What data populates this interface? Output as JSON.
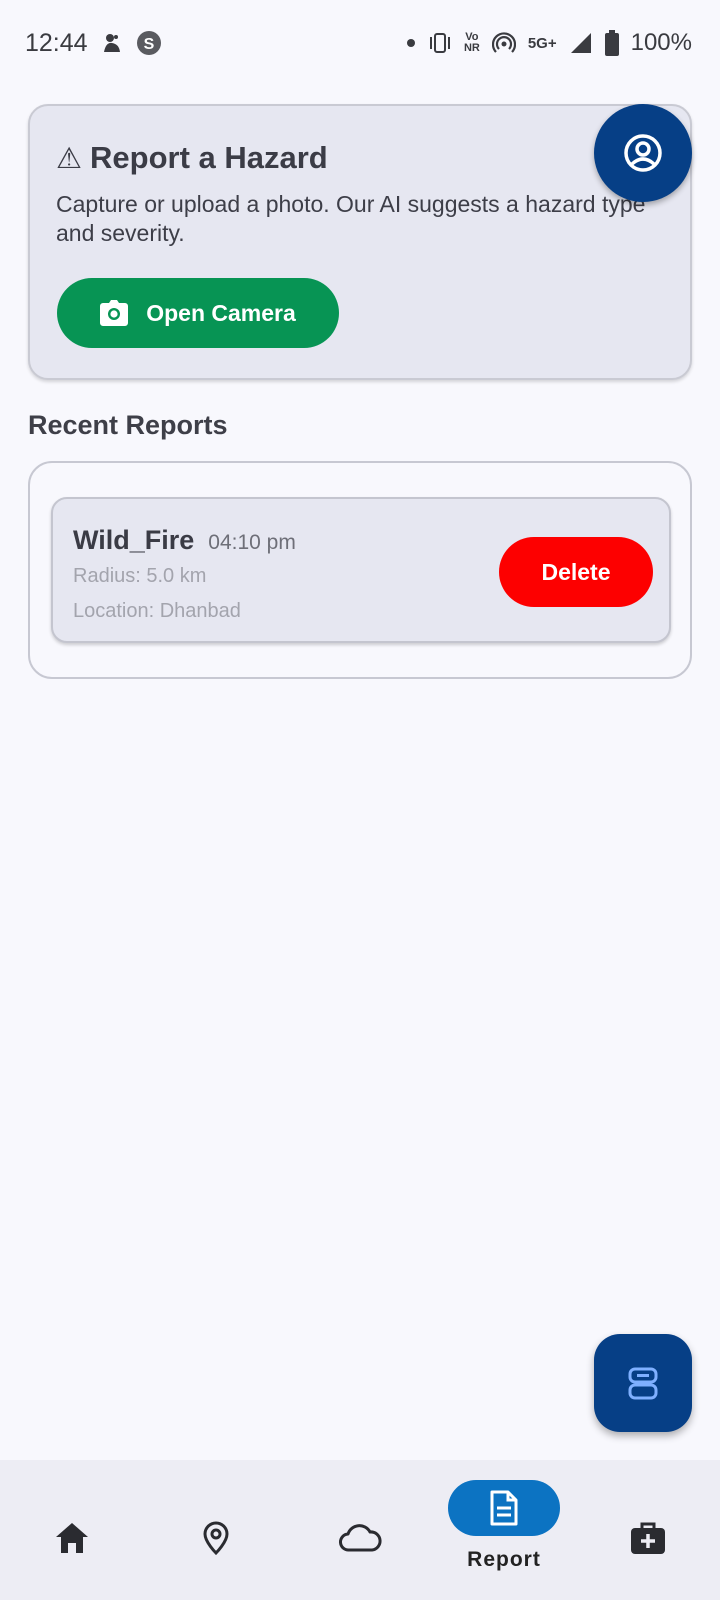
{
  "status_bar": {
    "time": "12:44",
    "battery": "100%",
    "network": "5G+",
    "volte_top": "Vo",
    "volte_bottom": "NR",
    "icons": [
      "emoji-icon",
      "s-app-icon",
      "dot-icon",
      "vibrate-icon",
      "vonr-icon",
      "hotspot-icon",
      "signal-icon",
      "battery-icon"
    ]
  },
  "hazard_card": {
    "title": "Report a Hazard",
    "warning_glyph": "⚠",
    "description": "Capture or upload a photo. Our AI suggests a hazard type and severity.",
    "camera_button_label": "Open Camera"
  },
  "recent": {
    "title": "Recent Reports",
    "reports": [
      {
        "name": "Wild_Fire",
        "time": "04:10 pm",
        "radius": "Radius: 5.0 km",
        "location": "Location: Dhanbad",
        "delete_label": "Delete"
      }
    ]
  },
  "bottom_nav": {
    "items": [
      {
        "icon": "home-icon",
        "label": ""
      },
      {
        "icon": "map-pin-icon",
        "label": ""
      },
      {
        "icon": "cloud-icon",
        "label": ""
      },
      {
        "icon": "document-icon",
        "label": "Report",
        "active": true
      },
      {
        "icon": "medical-kit-icon",
        "label": ""
      }
    ]
  },
  "colors": {
    "primary_dark": "#063f86",
    "camera_green": "#079454",
    "delete_red": "#fd0000",
    "nav_active": "#0c73c2"
  }
}
